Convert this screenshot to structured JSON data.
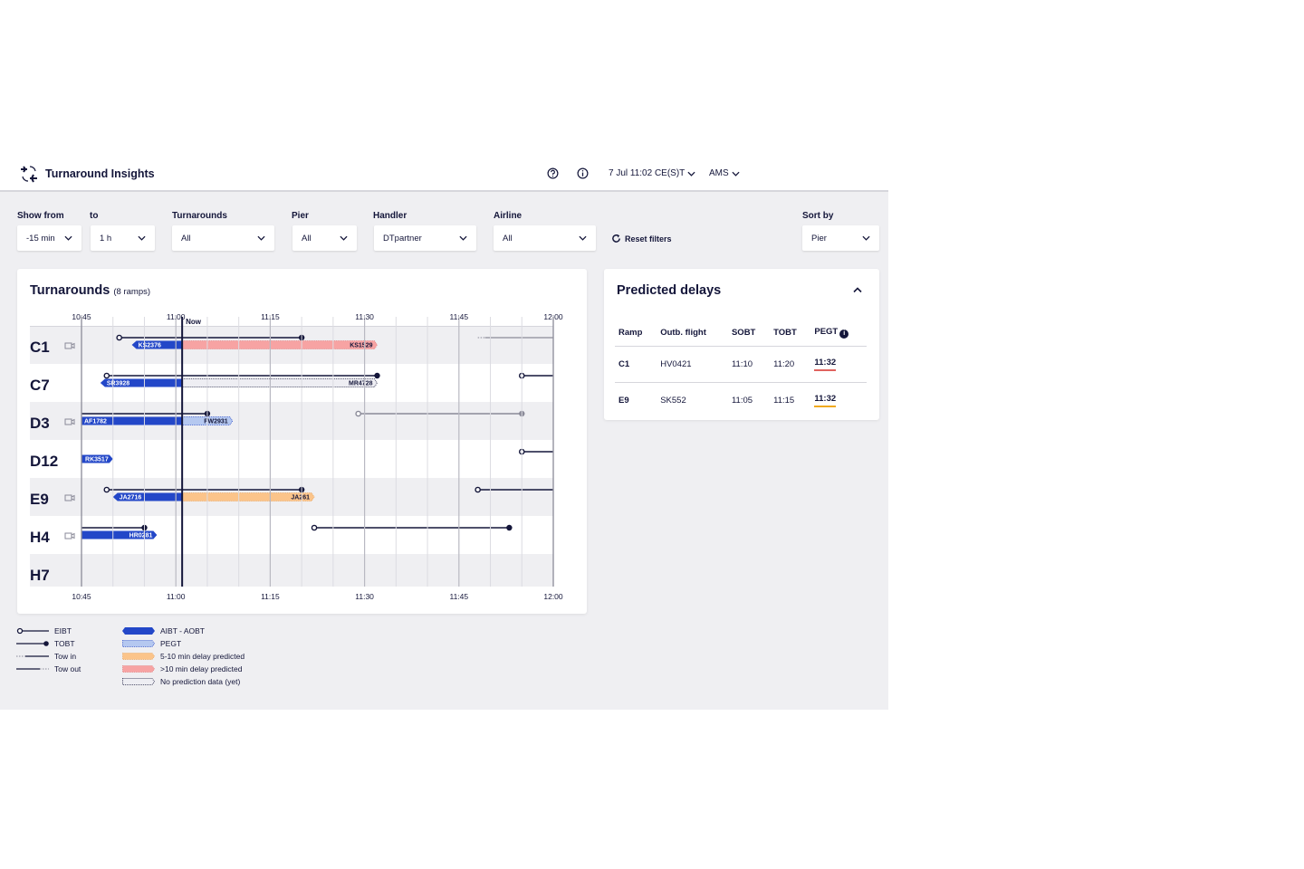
{
  "header": {
    "app_title": "Turnaround Insights",
    "logo_icon": "plane-turnaround-icon",
    "help_icon": "help-icon",
    "info_icon": "info-icon",
    "datetime": "7 Jul 11:02 CE(S)T",
    "airport": "AMS"
  },
  "filters": {
    "show_from": {
      "label": "Show from",
      "value": "-15 min"
    },
    "to": {
      "label": "to",
      "value": "1 h"
    },
    "turnarounds": {
      "label": "Turnarounds",
      "value": "All"
    },
    "pier": {
      "label": "Pier",
      "value": "All"
    },
    "handler": {
      "label": "Handler",
      "value": "DTpartner"
    },
    "airline": {
      "label": "Airline",
      "value": "All"
    },
    "reset": "Reset filters",
    "sort_by": {
      "label": "Sort by",
      "value": "Pier"
    }
  },
  "turnarounds_card": {
    "title": "Turnarounds",
    "subtitle": "(8 ramps)",
    "now_label": "Now"
  },
  "chart_data": {
    "type": "gantt",
    "title": "Turnarounds (8 ramps)",
    "x_axis": {
      "start": "10:45",
      "end": "12:00",
      "ticks": [
        "10:45",
        "11:00",
        "11:15",
        "11:30",
        "11:45",
        "12:00"
      ],
      "minor_grid_minutes": 5
    },
    "now": "11:01",
    "rows": [
      {
        "ramp": "C1",
        "camera": true,
        "turns": [
          {
            "eibt": "10:51",
            "tobt": "11:20"
          },
          {
            "tow_out_from": "11:48"
          }
        ],
        "bars": [
          {
            "type": "aibt-aobt",
            "label": "KS2376",
            "start": "10:53",
            "end": "11:01",
            "arrow": "left"
          },
          {
            "type": "delay-10plus",
            "label": "KS1529",
            "start": "11:01",
            "end": "11:32"
          }
        ]
      },
      {
        "ramp": "C7",
        "camera": false,
        "turns": [
          {
            "eibt": "10:49",
            "tobt": "11:32"
          },
          {
            "eibt": "11:55"
          }
        ],
        "bars": [
          {
            "type": "aibt-aobt",
            "label": "SR3928",
            "start": "10:48",
            "end": "11:01",
            "arrow": "left"
          },
          {
            "type": "no-prediction",
            "label": "MR4728",
            "start": "11:01",
            "end": "11:32"
          }
        ]
      },
      {
        "ramp": "D3",
        "camera": true,
        "turns": [
          {
            "eibt": null,
            "tobt": "11:05"
          },
          {
            "eibt": "11:29",
            "tobt": "11:55",
            "muted": true
          }
        ],
        "bars": [
          {
            "type": "aibt-aobt",
            "label": "AF1782",
            "start": "10:45",
            "end": "11:01"
          },
          {
            "type": "pegt",
            "label": "FW2931",
            "start": "11:01",
            "end": "11:09"
          }
        ]
      },
      {
        "ramp": "D12",
        "camera": false,
        "turns": [
          {
            "eibt": "11:55"
          }
        ],
        "bars": [
          {
            "type": "aibt-aobt",
            "label": "RK3517",
            "start": "10:45",
            "end": "10:50",
            "arrow": "right"
          }
        ]
      },
      {
        "ramp": "E9",
        "camera": true,
        "turns": [
          {
            "eibt": "10:49",
            "tobt": "11:20"
          },
          {
            "eibt": "11:48"
          }
        ],
        "bars": [
          {
            "type": "aibt-aobt",
            "label": "JA2716",
            "start": "10:50",
            "end": "11:01",
            "arrow": "left"
          },
          {
            "type": "delay-5-10",
            "label": "JA261",
            "start": "11:01",
            "end": "11:22"
          }
        ]
      },
      {
        "ramp": "H4",
        "camera": true,
        "turns": [
          {
            "eibt": null,
            "tobt": "10:55"
          },
          {
            "eibt": "11:22",
            "tobt": "11:53"
          }
        ],
        "bars": [
          {
            "type": "aibt-aobt",
            "label": "HR0281",
            "start": "10:45",
            "end": "10:57",
            "arrow": "right"
          }
        ]
      },
      {
        "ramp": "H7",
        "camera": false,
        "turns": [],
        "bars": [],
        "partial": true
      }
    ]
  },
  "legend": {
    "lines": [
      {
        "key": "eibt",
        "label": "EIBT"
      },
      {
        "key": "tobt",
        "label": "TOBT"
      },
      {
        "key": "tow-in",
        "label": "Tow in"
      },
      {
        "key": "tow-out",
        "label": "Tow out"
      }
    ],
    "bars": [
      {
        "key": "aibt-aobt",
        "label": "AIBT - AOBT"
      },
      {
        "key": "pegt",
        "label": "PEGT"
      },
      {
        "key": "delay-5-10",
        "label": "5-10 min delay predicted"
      },
      {
        "key": "delay-10plus",
        "label": ">10 min delay predicted"
      },
      {
        "key": "no-prediction",
        "label": "No prediction data (yet)"
      }
    ]
  },
  "predicted_delays": {
    "title": "Predicted delays",
    "columns": [
      "Ramp",
      "Outb. flight",
      "SOBT",
      "TOBT",
      "PEGT"
    ],
    "rows": [
      {
        "ramp": "C1",
        "flight": "HV0421",
        "sobt": "11:10",
        "tobt": "11:20",
        "pegt": "11:32",
        "severity": "delay-10plus"
      },
      {
        "ramp": "E9",
        "flight": "SK552",
        "sobt": "11:05",
        "tobt": "11:15",
        "pegt": "11:32",
        "severity": "delay-5-10"
      }
    ]
  },
  "colors": {
    "navy": "#14163a",
    "aibt_blue": "#2347c8",
    "pegt_blue": "#b5c8f0",
    "delay_orange": "#fbc48a",
    "delay_red": "#f7a3a3",
    "no_pred": "#eeeef3",
    "muted": "#8a8a98",
    "row_alt": "#efeff2",
    "underline_red": "#e0625f",
    "underline_orange": "#f0a91e"
  }
}
